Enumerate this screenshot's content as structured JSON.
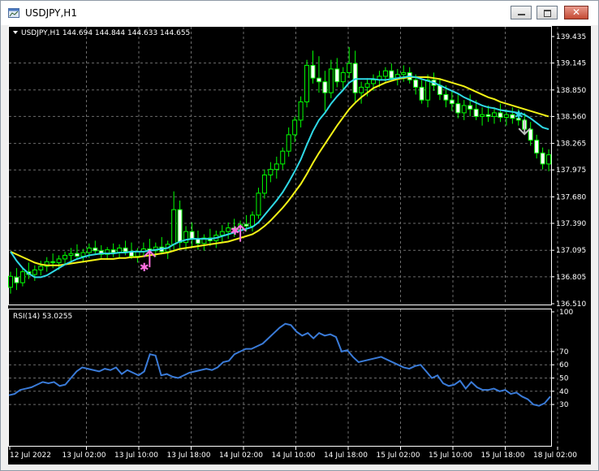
{
  "window": {
    "title": "USDJPY,H1",
    "icon": "chart-window-icon",
    "controls": {
      "minimize": "minimize-icon",
      "maximize": "maximize-icon",
      "close": "close-icon"
    }
  },
  "colors": {
    "background": "#000000",
    "grid": "#6c6c6c",
    "bull_candle": "#00ff00",
    "bear_candle": "#ffffff",
    "ma_fast": "#2fd9e6",
    "ma_slow": "#f4f416",
    "rsi_line": "#3a7bd8",
    "buy_arrow": "#ff70e0",
    "sell_arrow": "#c0c0c0"
  },
  "chart_data": [
    {
      "type": "candlestick",
      "symbol_info": "USDJPY,H1  144.694 144.844 144.633 144.655",
      "ylim": [
        136.51,
        139.435
      ],
      "price_ticks": [
        "139.435",
        "139.145",
        "138.850",
        "138.560",
        "138.265",
        "137.975",
        "137.680",
        "137.390",
        "137.095",
        "136.805",
        "136.510"
      ],
      "time_ticks": [
        "12 Jul 2022",
        "13 Jul 02:00",
        "13 Jul 10:00",
        "13 Jul 18:00",
        "14 Jul 02:00",
        "14 Jul 10:00",
        "14 Jul 18:00",
        "15 Jul 02:00",
        "15 Jul 10:00",
        "15 Jul 18:00",
        "18 Jul 02:00"
      ],
      "candles": [
        [
          136.69,
          136.86,
          136.62,
          136.81
        ],
        [
          136.8,
          136.9,
          136.66,
          136.74
        ],
        [
          136.74,
          136.9,
          136.7,
          136.86
        ],
        [
          136.86,
          136.96,
          136.78,
          136.83
        ],
        [
          136.83,
          136.93,
          136.76,
          136.88
        ],
        [
          136.88,
          136.98,
          136.82,
          136.92
        ],
        [
          136.92,
          137.02,
          136.86,
          136.97
        ],
        [
          136.97,
          137.06,
          136.9,
          136.96
        ],
        [
          136.96,
          137.04,
          136.88,
          137.0
        ],
        [
          137.0,
          137.08,
          136.94,
          137.04
        ],
        [
          137.04,
          137.12,
          136.96,
          137.06
        ],
        [
          137.06,
          137.16,
          137.0,
          137.03
        ],
        [
          137.03,
          137.11,
          136.96,
          137.07
        ],
        [
          137.07,
          137.17,
          137.01,
          137.12
        ],
        [
          137.12,
          137.2,
          137.05,
          137.09
        ],
        [
          137.09,
          137.15,
          137.01,
          137.05
        ],
        [
          137.05,
          137.13,
          136.99,
          137.1
        ],
        [
          137.1,
          137.17,
          137.02,
          137.07
        ],
        [
          137.07,
          137.16,
          137.01,
          137.12
        ],
        [
          137.12,
          137.2,
          137.04,
          137.08
        ],
        [
          137.08,
          137.18,
          137.0,
          137.03
        ],
        [
          137.03,
          137.12,
          136.96,
          137.08
        ],
        [
          137.08,
          137.18,
          137.02,
          137.11
        ],
        [
          137.11,
          137.22,
          137.04,
          137.09
        ],
        [
          137.09,
          137.18,
          137.02,
          137.13
        ],
        [
          137.13,
          137.24,
          137.05,
          137.08
        ],
        [
          137.08,
          137.2,
          137.0,
          137.16
        ],
        [
          137.16,
          137.74,
          137.1,
          137.54
        ],
        [
          137.54,
          137.64,
          137.12,
          137.18
        ],
        [
          137.18,
          137.36,
          137.1,
          137.3
        ],
        [
          137.3,
          137.4,
          137.12,
          137.22
        ],
        [
          137.22,
          137.31,
          137.1,
          137.17
        ],
        [
          137.17,
          137.27,
          137.09,
          137.23
        ],
        [
          137.23,
          137.33,
          137.14,
          137.2
        ],
        [
          137.2,
          137.31,
          137.12,
          137.26
        ],
        [
          137.26,
          137.37,
          137.18,
          137.3
        ],
        [
          137.3,
          137.4,
          137.22,
          137.34
        ],
        [
          137.34,
          137.44,
          137.24,
          137.32
        ],
        [
          137.32,
          137.42,
          137.24,
          137.38
        ],
        [
          137.38,
          137.48,
          137.3,
          137.36
        ],
        [
          137.36,
          137.52,
          137.3,
          137.48
        ],
        [
          137.48,
          137.78,
          137.44,
          137.72
        ],
        [
          137.72,
          137.98,
          137.66,
          137.92
        ],
        [
          137.92,
          138.06,
          137.84,
          137.98
        ],
        [
          137.98,
          138.12,
          137.88,
          138.04
        ],
        [
          138.04,
          138.22,
          137.98,
          138.18
        ],
        [
          138.18,
          138.44,
          138.12,
          138.36
        ],
        [
          138.36,
          138.56,
          138.28,
          138.52
        ],
        [
          138.52,
          138.78,
          138.44,
          138.72
        ],
        [
          138.72,
          139.18,
          138.66,
          139.12
        ],
        [
          139.12,
          139.28,
          138.92,
          138.98
        ],
        [
          138.98,
          139.22,
          138.82,
          138.94
        ],
        [
          138.94,
          139.06,
          138.62,
          138.82
        ],
        [
          138.82,
          139.18,
          138.76,
          139.08
        ],
        [
          139.08,
          139.2,
          138.88,
          138.94
        ],
        [
          138.94,
          139.1,
          138.84,
          139.04
        ],
        [
          139.04,
          139.32,
          138.98,
          139.14
        ],
        [
          139.14,
          139.28,
          138.72,
          138.82
        ],
        [
          138.82,
          138.94,
          138.7,
          138.88
        ],
        [
          138.88,
          138.98,
          138.78,
          138.92
        ],
        [
          138.92,
          139.02,
          138.84,
          138.96
        ],
        [
          138.96,
          139.06,
          138.88,
          139.0
        ],
        [
          139.0,
          139.1,
          138.94,
          139.06
        ],
        [
          139.06,
          139.14,
          138.96,
          138.98
        ],
        [
          138.98,
          139.08,
          138.9,
          139.02
        ],
        [
          139.02,
          139.12,
          138.94,
          139.04
        ],
        [
          139.04,
          139.1,
          138.92,
          138.96
        ],
        [
          138.96,
          139.02,
          138.8,
          138.88
        ],
        [
          138.88,
          138.96,
          138.7,
          138.74
        ],
        [
          138.74,
          139.02,
          138.66,
          138.96
        ],
        [
          138.96,
          139.04,
          138.84,
          138.9
        ],
        [
          138.9,
          138.98,
          138.74,
          138.8
        ],
        [
          138.8,
          138.9,
          138.66,
          138.74
        ],
        [
          138.74,
          138.84,
          138.62,
          138.7
        ],
        [
          138.7,
          138.8,
          138.54,
          138.6
        ],
        [
          138.6,
          138.74,
          138.52,
          138.68
        ],
        [
          138.68,
          138.8,
          138.56,
          138.64
        ],
        [
          138.64,
          138.74,
          138.52,
          138.56
        ],
        [
          138.56,
          138.66,
          138.46,
          138.58
        ],
        [
          138.58,
          138.68,
          138.5,
          138.56
        ],
        [
          138.56,
          138.66,
          138.48,
          138.6
        ],
        [
          138.6,
          138.7,
          138.5,
          138.55
        ],
        [
          138.55,
          138.64,
          138.46,
          138.58
        ],
        [
          138.58,
          138.66,
          138.48,
          138.54
        ],
        [
          138.54,
          138.64,
          138.46,
          138.52
        ],
        [
          138.52,
          138.6,
          138.38,
          138.42
        ],
        [
          138.42,
          138.5,
          138.24,
          138.3
        ],
        [
          138.3,
          138.36,
          138.1,
          138.16
        ],
        [
          138.16,
          138.22,
          137.98,
          138.04
        ],
        [
          138.04,
          138.2,
          137.96,
          138.14
        ]
      ],
      "ma_fast": [
        137.08,
        136.98,
        136.9,
        136.84,
        136.8,
        136.8,
        136.82,
        136.86,
        136.9,
        136.94,
        136.97,
        137.0,
        137.02,
        137.04,
        137.05,
        137.06,
        137.06,
        137.06,
        137.07,
        137.07,
        137.08,
        137.08,
        137.08,
        137.09,
        137.1,
        137.11,
        137.12,
        137.16,
        137.19,
        137.21,
        137.22,
        137.22,
        137.22,
        137.22,
        137.23,
        137.25,
        137.27,
        137.29,
        137.31,
        137.33,
        137.35,
        137.4,
        137.48,
        137.56,
        137.64,
        137.73,
        137.84,
        137.96,
        138.09,
        138.25,
        138.4,
        138.52,
        138.6,
        138.7,
        138.78,
        138.85,
        138.93,
        138.97,
        138.97,
        138.97,
        138.97,
        138.96,
        138.96,
        138.97,
        138.98,
        138.99,
        139.0,
        138.99,
        138.97,
        138.95,
        138.93,
        138.9,
        138.87,
        138.84,
        138.81,
        138.77,
        138.74,
        138.71,
        138.68,
        138.66,
        138.65,
        138.63,
        138.62,
        138.61,
        138.6,
        138.58,
        138.54,
        138.49,
        138.44,
        138.42
      ],
      "ma_slow": [
        137.08,
        137.05,
        137.02,
        136.99,
        136.96,
        136.94,
        136.93,
        136.93,
        136.93,
        136.94,
        136.95,
        136.96,
        136.97,
        136.98,
        136.99,
        137.0,
        137.0,
        137.0,
        137.01,
        137.01,
        137.02,
        137.02,
        137.03,
        137.04,
        137.05,
        137.06,
        137.07,
        137.09,
        137.11,
        137.12,
        137.13,
        137.14,
        137.15,
        137.16,
        137.17,
        137.18,
        137.19,
        137.21,
        137.23,
        137.25,
        137.27,
        137.31,
        137.36,
        137.42,
        137.49,
        137.56,
        137.64,
        137.73,
        137.82,
        137.93,
        138.05,
        138.16,
        138.26,
        138.36,
        138.46,
        138.55,
        138.64,
        138.71,
        138.77,
        138.82,
        138.87,
        138.9,
        138.93,
        138.95,
        138.97,
        138.98,
        138.99,
        138.99,
        138.99,
        138.99,
        138.98,
        138.97,
        138.95,
        138.93,
        138.91,
        138.89,
        138.86,
        138.83,
        138.8,
        138.77,
        138.75,
        138.72,
        138.7,
        138.68,
        138.66,
        138.64,
        138.62,
        138.6,
        138.58,
        138.56
      ],
      "buy_arrows": [
        {
          "index": 23,
          "price": 136.98
        },
        {
          "index": 38,
          "price": 137.26
        }
      ],
      "buy_stars": [
        {
          "index": 22,
          "price": 136.92
        },
        {
          "index": 37,
          "price": 137.32
        }
      ],
      "sell_arrows": [
        {
          "index": 85,
          "price": 138.42
        }
      ],
      "sell_stars": [
        {
          "index": 84,
          "price": 138.58
        }
      ]
    },
    {
      "type": "line",
      "label": "RSI(14) 53.0255",
      "ylim": [
        0,
        100
      ],
      "levels": [
        "100",
        "70",
        "60",
        "50",
        "40",
        "30"
      ],
      "values": [
        37,
        38,
        41,
        42,
        43,
        45,
        47,
        46,
        47,
        44,
        45,
        50,
        55,
        58,
        57,
        56,
        55,
        57,
        56,
        58,
        53,
        56,
        54,
        52,
        55,
        68,
        67,
        52,
        53,
        51,
        50,
        52,
        54,
        55,
        56,
        57,
        56,
        58,
        62,
        63,
        68,
        70,
        72,
        72,
        74,
        76,
        80,
        84,
        88,
        91,
        90,
        85,
        82,
        84,
        80,
        84,
        82,
        83,
        81,
        70,
        71,
        66,
        62,
        63,
        64,
        65,
        66,
        64,
        62,
        60,
        58,
        57,
        59,
        60,
        55,
        50,
        52,
        46,
        44,
        45,
        48,
        42,
        47,
        43,
        41,
        41,
        42,
        40,
        41,
        38,
        39,
        36,
        34,
        30,
        29,
        31,
        36
      ]
    }
  ]
}
